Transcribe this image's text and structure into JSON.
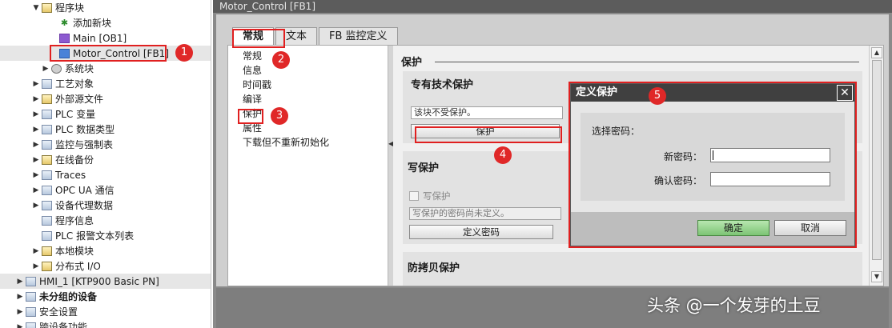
{
  "tree": {
    "items": [
      {
        "label": "程序块",
        "arrow": "▼"
      },
      {
        "label": "添加新块",
        "arrow": ""
      },
      {
        "label": "Main [OB1]",
        "arrow": ""
      },
      {
        "label": "Motor_Control [FB1]",
        "arrow": ""
      },
      {
        "label": "系统块",
        "arrow": "▶"
      },
      {
        "label": "工艺对象",
        "arrow": "▶"
      },
      {
        "label": "外部源文件",
        "arrow": "▶"
      },
      {
        "label": "PLC 变量",
        "arrow": "▶"
      },
      {
        "label": "PLC 数据类型",
        "arrow": "▶"
      },
      {
        "label": "监控与强制表",
        "arrow": "▶"
      },
      {
        "label": "在线备份",
        "arrow": "▶"
      },
      {
        "label": "Traces",
        "arrow": "▶"
      },
      {
        "label": "OPC UA 通信",
        "arrow": "▶"
      },
      {
        "label": "设备代理数据",
        "arrow": "▶"
      },
      {
        "label": "程序信息",
        "arrow": ""
      },
      {
        "label": "PLC 报警文本列表",
        "arrow": ""
      },
      {
        "label": "本地模块",
        "arrow": "▶"
      },
      {
        "label": "分布式 I/O",
        "arrow": "▶"
      },
      {
        "label": "HMI_1 [KTP900 Basic PN]",
        "arrow": "▶"
      },
      {
        "label": "未分组的设备",
        "arrow": "▶"
      },
      {
        "label": "安全设置",
        "arrow": "▶"
      },
      {
        "label": "跨设备功能",
        "arrow": "▶"
      }
    ]
  },
  "badges": [
    "1",
    "2",
    "3",
    "4",
    "5"
  ],
  "editor": {
    "title": "Motor_Control [FB1]",
    "tabs": [
      "常规",
      "文本",
      "FB 监控定义"
    ],
    "nav": [
      "常规",
      "信息",
      "时间戳",
      "编译",
      "保护",
      "属性",
      "下载但不重新初始化"
    ],
    "protection": {
      "heading": "保护",
      "know_how_title": "专有技术保护",
      "know_how_status": "该块不受保护。",
      "protect_button": "保护",
      "write_title": "写保护",
      "write_checkbox": "写保护",
      "write_status": "写保护的密码尚未定义。",
      "define_password_button": "定义密码",
      "copy_title": "防拷贝保护"
    }
  },
  "dialog": {
    "title": "定义保护",
    "close": "✕",
    "prompt": "选择密码：",
    "new_password_label": "新密码：",
    "confirm_password_label": "确认密码：",
    "ok_label": "确定",
    "cancel_label": "取消"
  },
  "watermark": "头条 @一个发芽的土豆",
  "colors": {
    "marker": "#e02020",
    "ok_button": "#7cc474",
    "title_bar": "#404040"
  }
}
